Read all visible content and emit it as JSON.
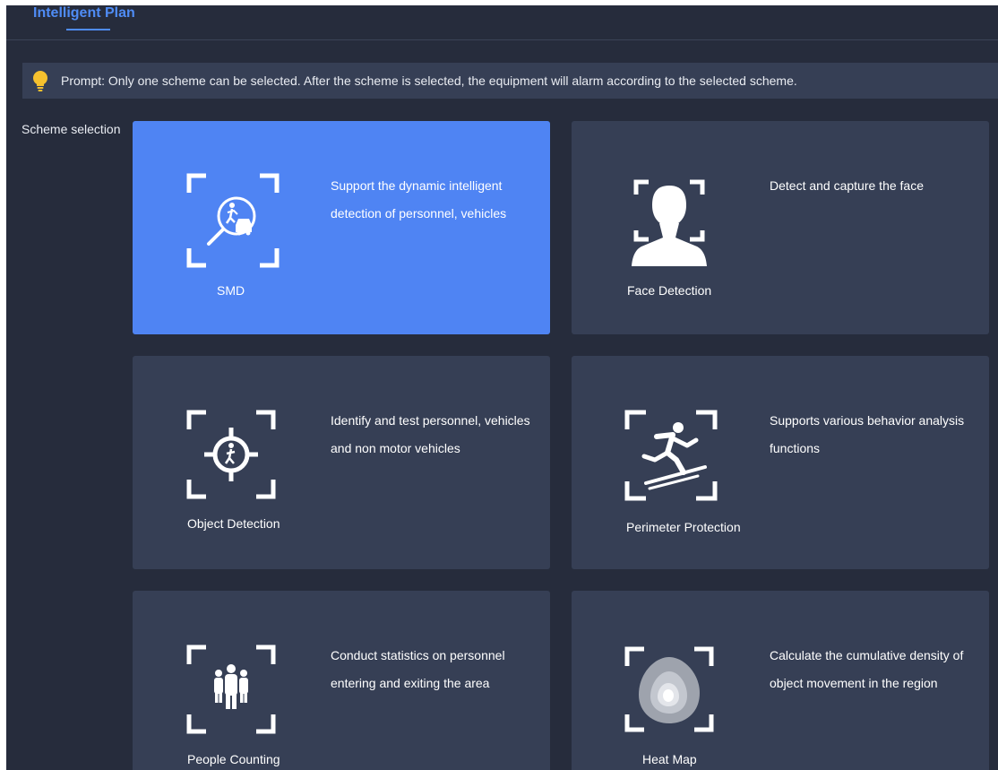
{
  "header": {
    "tab_title": "Intelligent Plan"
  },
  "prompt": {
    "icon": "lightbulb-icon",
    "text": "Prompt: Only one scheme can be selected. After the scheme is selected, the equipment will alarm according to the selected scheme."
  },
  "scheme_selection": {
    "label": "Scheme selection",
    "selected": "SMD",
    "cards": [
      {
        "name": "SMD",
        "icon": "smd-icon",
        "description": "Support the dynamic intelligent detection of personnel, vehicles"
      },
      {
        "name": "Face Detection",
        "icon": "face-detection-icon",
        "description": "Detect and capture the face"
      },
      {
        "name": "Object Detection",
        "icon": "object-detection-icon",
        "description": "Identify and test personnel, vehicles and non motor vehicles"
      },
      {
        "name": "Perimeter Protection",
        "icon": "perimeter-protection-icon",
        "description": "Supports various behavior analysis functions"
      },
      {
        "name": "People Counting",
        "icon": "people-counting-icon",
        "description": "Conduct statistics on personnel entering and exiting the area"
      },
      {
        "name": "Heat Map",
        "icon": "heat-map-icon",
        "description": "Calculate the cumulative density of object movement in the region"
      }
    ]
  },
  "colors": {
    "background": "#262c3c",
    "card": "#363f55",
    "card_selected": "#4f84f3",
    "accent": "#4f8cf5",
    "bulb": "#f6c12e"
  }
}
